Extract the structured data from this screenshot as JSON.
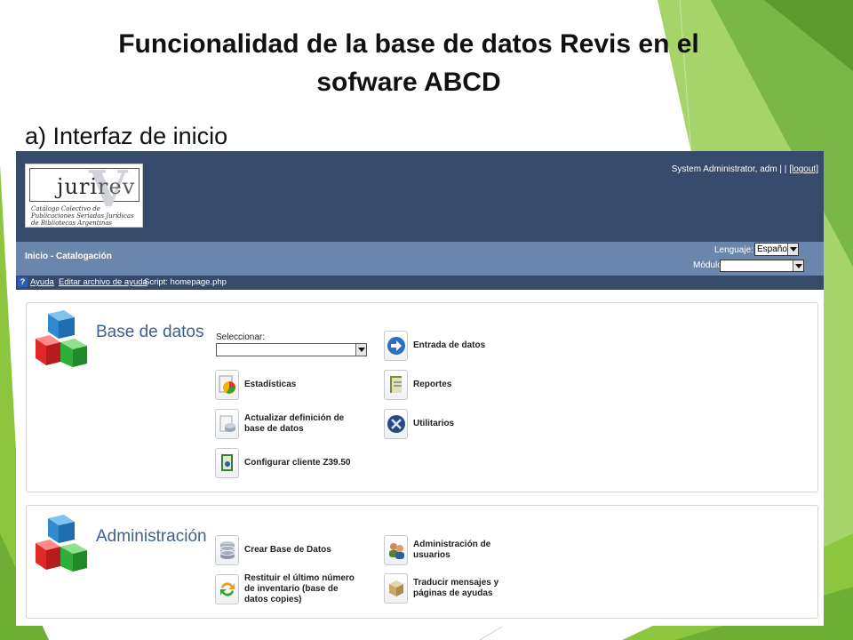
{
  "slide": {
    "title_line1": "Funcionalidad de la base de datos Revis en el",
    "title_line2": "sofware ABCD",
    "subtitle": "a) Interfaz de inicio"
  },
  "colors": {
    "header_bg": "#364a6b",
    "nav_bg": "#6b86ad",
    "section_title": "#3e5f92",
    "slide_green": "#7ab648"
  },
  "app": {
    "logo": {
      "word": "juri",
      "word_tail": "rev",
      "caption": "Catálogo Colectivo de Publicaciones Seriadas Jurídicas de Bibliotecas Argentinas"
    },
    "user": {
      "name": "System Administrator, adm | |",
      "logout": "[logout]"
    },
    "nav": {
      "inicio": "Inicio",
      "separator": " - ",
      "section": "Catalogación",
      "language_label": "Lenguaje:",
      "language_value": "Español",
      "module_label": "Módulo",
      "module_value": ""
    },
    "help_bar": {
      "ayuda": "Ayuda",
      "editar": "Editar archivo de ayuda",
      "script": "Script: homepage.php"
    },
    "database_panel": {
      "title": "Base de datos",
      "select_label": "Seleccionar:",
      "select_value": "",
      "actions": {
        "entrada": "Entrada de datos",
        "estadisticas": "Estadísticas",
        "reportes": "Reportes",
        "actualizar": "Actualizar definición de base de datos",
        "utilitarios": "Utilitarios",
        "configurar": "Configurar cliente Z39.50"
      }
    },
    "admin_panel": {
      "title": "Administración",
      "actions": {
        "crear": "Crear Base de Datos",
        "usuarios": "Administración de usuarios",
        "restituir": "Restituir el último número de inventario (base de datos copies)",
        "traducir": "Traducir mensajes y páginas de ayudas"
      }
    }
  }
}
